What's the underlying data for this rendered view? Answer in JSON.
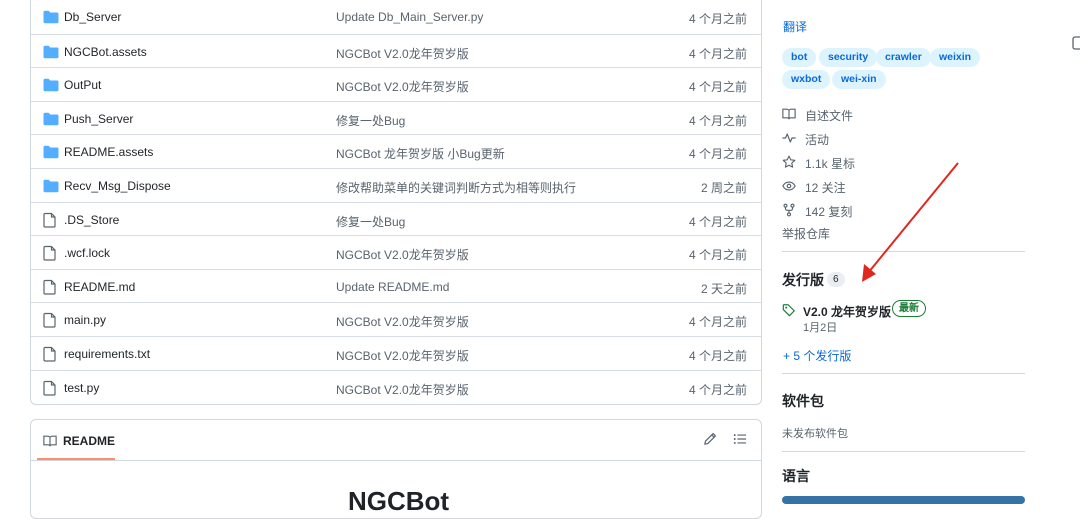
{
  "files": [
    {
      "name": "Db_Server",
      "type": "folder",
      "message": "Update Db_Main_Server.py",
      "time": "4 个月之前"
    },
    {
      "name": "NGCBot.assets",
      "type": "folder",
      "message": "NGCBot V2.0龙年贺岁版",
      "time": "4 个月之前"
    },
    {
      "name": "OutPut",
      "type": "folder",
      "message": "NGCBot V2.0龙年贺岁版",
      "time": "4 个月之前"
    },
    {
      "name": "Push_Server",
      "type": "folder",
      "message": "修复一处Bug",
      "time": "4 个月之前"
    },
    {
      "name": "README.assets",
      "type": "folder",
      "message": "NGCBot 龙年贺岁版 小Bug更新",
      "time": "4 个月之前"
    },
    {
      "name": "Recv_Msg_Dispose",
      "type": "folder",
      "message": "修改帮助菜单的关键词判断方式为相等则执行",
      "time": "2 周之前"
    },
    {
      "name": ".DS_Store",
      "type": "file",
      "message": "修复一处Bug",
      "time": "4 个月之前"
    },
    {
      "name": ".wcf.lock",
      "type": "file",
      "message": "NGCBot V2.0龙年贺岁版",
      "time": "4 个月之前"
    },
    {
      "name": "README.md",
      "type": "file",
      "message": "Update README.md",
      "time": "2 天之前"
    },
    {
      "name": "main.py",
      "type": "file",
      "message": "NGCBot V2.0龙年贺岁版",
      "time": "4 个月之前"
    },
    {
      "name": "requirements.txt",
      "type": "file",
      "message": "NGCBot V2.0龙年贺岁版",
      "time": "4 个月之前"
    },
    {
      "name": "test.py",
      "type": "file",
      "message": "NGCBot V2.0龙年贺岁版",
      "time": "4 个月之前"
    }
  ],
  "readme": {
    "tab_label": "README",
    "title": "NGCBot",
    "edit_icon": "pencil-icon",
    "outline_icon": "list-icon"
  },
  "sidebar": {
    "translate_link": "翻译",
    "topics": [
      "bot",
      "security",
      "crawler",
      "weixin",
      "wxbot",
      "wei-xin"
    ],
    "meta": [
      {
        "icon": "book-icon",
        "text": "自述文件"
      },
      {
        "icon": "pulse-icon",
        "text": "活动"
      },
      {
        "icon": "star-icon",
        "text": "1.1k 星标"
      },
      {
        "icon": "eye-icon",
        "text": "12 关注"
      },
      {
        "icon": "fork-icon",
        "text": "142 复刻"
      }
    ],
    "report_link": "举报仓库",
    "releases": {
      "heading": "发行版",
      "count": "6",
      "latest_name": "V2.0 龙年贺岁版",
      "latest_badge": "最新",
      "latest_date": "1月2日",
      "more_link": "+ 5 个发行版"
    },
    "packages": {
      "heading": "软件包",
      "none_text": "未发布软件包"
    },
    "languages": {
      "heading": "语言"
    }
  },
  "colors": {
    "accent": "#0969da",
    "folder": "#54aeff",
    "annotation_arrow": "#e0271f",
    "latest_badge": "#1a7f37",
    "readme_tab_underline": "#fd8c73"
  }
}
